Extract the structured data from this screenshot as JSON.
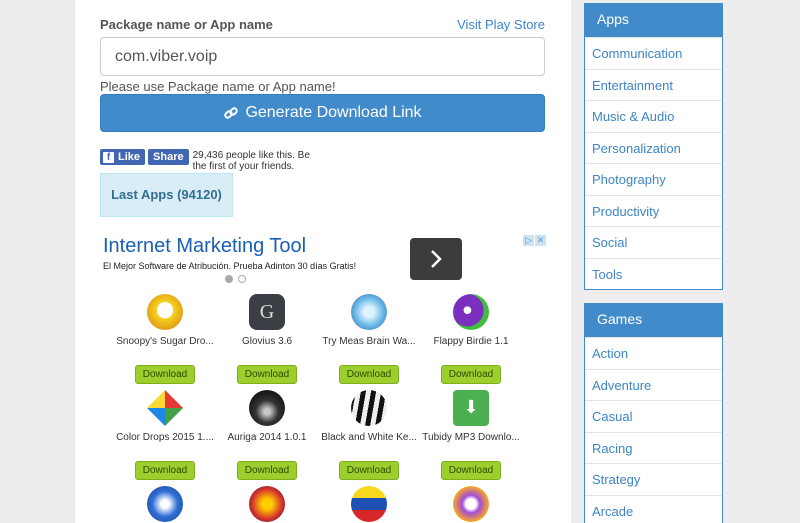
{
  "form": {
    "label": "Package name or App name",
    "play_link": "Visit Play Store",
    "input_value": "com.viber.voip",
    "hint": "Please use Package name or App name!",
    "generate_label": "Generate Download Link"
  },
  "facebook": {
    "like": "Like",
    "share": "Share",
    "count_text": "29,436 people like this. Be the first of your friends."
  },
  "last_apps": "Last Apps (94120)",
  "ad": {
    "title": "Internet Marketing Tool",
    "subtitle": "El Mejor Software de Atribución. Prueba Adinton 30 días Gratis!"
  },
  "apps": [
    {
      "name": "Snoopy's Sugar Dro...",
      "icon": "snoopy-icon",
      "download": "Download"
    },
    {
      "name": "Glovius 3.6",
      "icon": "glovius-icon",
      "download": "Download"
    },
    {
      "name": "Try Meas Brain Wa...",
      "icon": "brain-wave-icon",
      "download": "Download"
    },
    {
      "name": "Flappy Birdie 1.1",
      "icon": "flappy-birdie-icon",
      "download": "Download"
    },
    {
      "name": "Color Drops 2015 1....",
      "icon": "color-drops-icon",
      "download": "Download"
    },
    {
      "name": "Auriga 2014 1.0.1",
      "icon": "auriga-icon",
      "download": "Download"
    },
    {
      "name": "Black and White Ke...",
      "icon": "black-white-keys-icon",
      "download": "Download"
    },
    {
      "name": "Tubidy MP3 Downlo...",
      "icon": "tubidy-icon",
      "download": "Download"
    },
    {
      "name": "",
      "icon": "app-icon-9",
      "download": ""
    },
    {
      "name": "",
      "icon": "app-icon-10",
      "download": ""
    },
    {
      "name": "",
      "icon": "app-icon-11",
      "download": ""
    },
    {
      "name": "",
      "icon": "app-icon-12",
      "download": ""
    }
  ],
  "sidebar_apps": {
    "title": "Apps",
    "items": [
      "Communication",
      "Entertainment",
      "Music & Audio",
      "Personalization",
      "Photography",
      "Productivity",
      "Social",
      "Tools"
    ]
  },
  "sidebar_games": {
    "title": "Games",
    "items": [
      "Action",
      "Adventure",
      "Casual",
      "Racing",
      "Strategy",
      "Arcade"
    ]
  }
}
